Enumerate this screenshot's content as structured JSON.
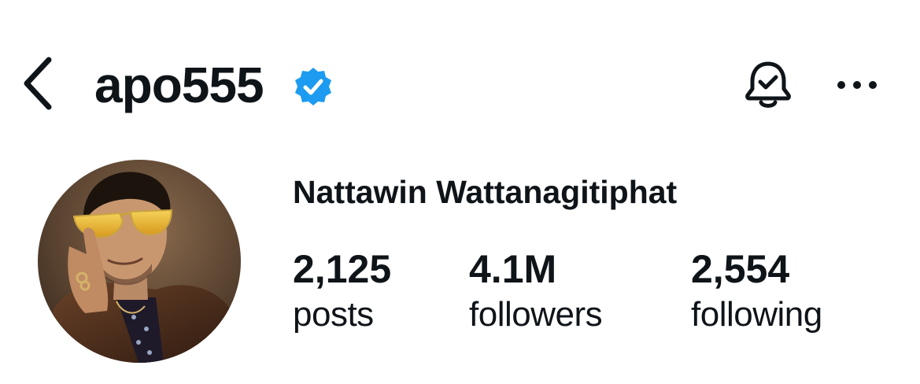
{
  "header": {
    "username": "apo555",
    "back_icon": "chevron-left-icon",
    "verified_icon": "verified-badge-icon",
    "verified_color": "#1d9bf0",
    "bell_icon": "bell-check-icon",
    "more_icon": "ellipsis-icon"
  },
  "profile": {
    "full_name": "Nattawin Wattanagitiphat",
    "avatar": "profile-photo",
    "stats": [
      {
        "count": "2,125",
        "label": "posts"
      },
      {
        "count": "4.1M",
        "label": "followers"
      },
      {
        "count": "2,554",
        "label": "following"
      }
    ]
  },
  "colors": {
    "text": "#0f1419",
    "background": "#ffffff"
  }
}
